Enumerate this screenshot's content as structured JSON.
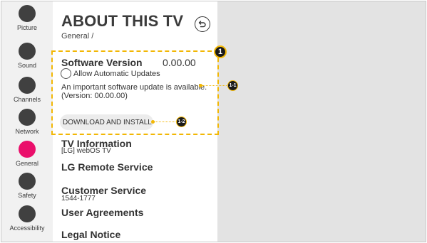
{
  "sidebar": {
    "items": [
      {
        "label": "Picture",
        "active": false
      },
      {
        "label": "Sound",
        "active": false
      },
      {
        "label": "Channels",
        "active": false
      },
      {
        "label": "Network",
        "active": false
      },
      {
        "label": "General",
        "active": true
      },
      {
        "label": "Safety",
        "active": false
      },
      {
        "label": "Accessibility",
        "active": false
      }
    ]
  },
  "panel": {
    "title": "ABOUT THIS TV",
    "breadcrumb": "General /",
    "back_icon": "back-arrow-icon",
    "software": {
      "title": "Software Version",
      "version": "0.00.00",
      "auto_update_label": "Allow Automatic Updates",
      "notice_line1": "An important software update is available.",
      "notice_line2": "(Version: 00.00.00)",
      "download_button": "DOWNLOAD AND INSTALL"
    },
    "items": [
      {
        "title": "TV Information",
        "sub": "[LG] webOS TV"
      },
      {
        "title": "LG Remote Service",
        "sub": ""
      },
      {
        "title": "Customer Service",
        "sub": "1544-1777"
      },
      {
        "title": "User Agreements",
        "sub": ""
      },
      {
        "title": "Legal Notice",
        "sub": ""
      }
    ]
  },
  "annotations": {
    "main": "1",
    "notice_callout": "1-1",
    "button_callout": "1-2"
  },
  "colors": {
    "accent_active": "#ea0f6b",
    "annotation": "#f2b705",
    "sidebar_bg": "#f1f1f1",
    "screen_bg": "#e3e3e3"
  }
}
